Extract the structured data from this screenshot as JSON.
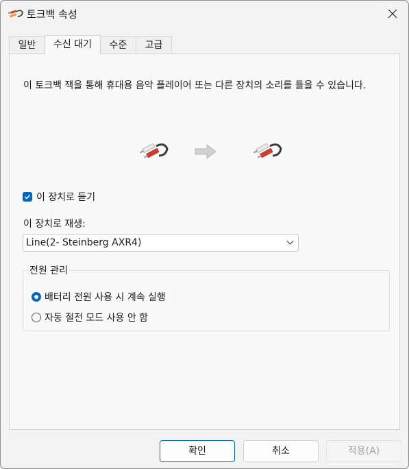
{
  "window": {
    "title": "토크백 속성",
    "title_icon": "audio-jack-icon",
    "close_icon": "close-icon"
  },
  "tabs": [
    {
      "label": "일반",
      "active": false
    },
    {
      "label": "수신 대기",
      "active": true
    },
    {
      "label": "수준",
      "active": false
    },
    {
      "label": "고급",
      "active": false
    }
  ],
  "listen": {
    "description": "이 토크백 잭을 통해 휴대용 음악 플레이어 또는 다른 장치의 소리를 들을 수 있습니다.",
    "source_icon": "audio-jack-icon",
    "arrow_icon": "arrow-right-icon",
    "target_icon": "audio-jack-icon",
    "listen_checkbox": {
      "label": "이 장치로 듣기",
      "checked": true
    },
    "playback_label": "이 장치로 재생:",
    "playback_device": {
      "selected": "Line(2- Steinberg AXR4)"
    }
  },
  "power": {
    "legend": "전원 관리",
    "options": [
      {
        "label": "배터리 전원 사용 시 계속 실행",
        "selected": true
      },
      {
        "label": "자동 절전 모드 사용 안 함",
        "selected": false
      }
    ]
  },
  "buttons": {
    "ok": "확인",
    "cancel": "취소",
    "apply": "적용(A)"
  },
  "colors": {
    "accent": "#0067c0",
    "jack_red": "#d43a2a",
    "jack_white": "#e8e8e8",
    "arrow_gray": "#c8c8c8"
  }
}
